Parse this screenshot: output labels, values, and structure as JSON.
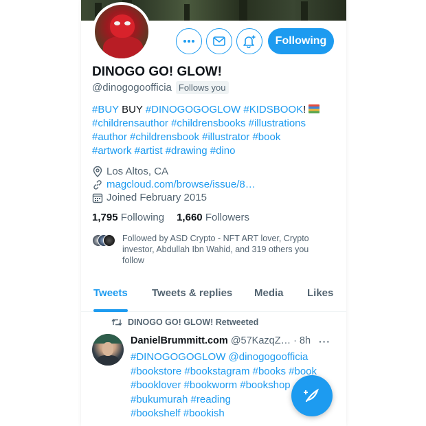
{
  "profile": {
    "name": "DINOGO GO! GLOW!",
    "handle": "@dinogogoofficia",
    "follows_you": "Follows you",
    "follow_button": "Following"
  },
  "bio": {
    "line1": {
      "buy_tag": "#BUY",
      "buy_word": "BUY",
      "tag1": "#DINOGOGOGLOW",
      "tag2": "#KIDSBOOK",
      "bang": "!"
    },
    "line2": "#childrensauthor #childrensbooks #illustrations",
    "line3": "#author #childrensbook #illustrator #book",
    "line4": "#artwork #artist #drawing #dino"
  },
  "meta": {
    "location": "Los Altos, CA",
    "link": "magcloud.com/browse/issue/8…",
    "joined": "Joined February 2015"
  },
  "stats": {
    "following_count": "1,795",
    "following_label": "Following",
    "followers_count": "1,660",
    "followers_label": "Followers"
  },
  "followed_by": "Followed by ASD Crypto - NFT ART lover, Crypto investor, Abdullah Ibn Wahid, and 319 others you follow",
  "tabs": {
    "tweets": "Tweets",
    "replies": "Tweets & replies",
    "media": "Media",
    "likes": "Likes"
  },
  "tweet": {
    "retweet_label": "DINOGO GO! GLOW! Retweeted",
    "author": "DanielBrummitt.com",
    "handle": "@57KazqZ…",
    "time": "· 8h",
    "more": "···",
    "lines": [
      "#DINOGOGOGLOW @dinogogoofficia",
      "#bookstore #bookstagram #books #book",
      "#booklover #bookworm #bookshop",
      "#bukumurah #reading",
      "#bookshelf #bookish"
    ]
  },
  "icons": {
    "more": "more-icon",
    "message": "mail-icon",
    "notify": "bell-plus-icon",
    "location": "location-pin-icon",
    "link": "link-icon",
    "calendar": "calendar-icon",
    "retweet": "retweet-icon",
    "compose": "compose-feather-icon"
  },
  "colors": {
    "accent": "#1d9bf0",
    "text": "#0f1419",
    "secondary": "#536471"
  }
}
